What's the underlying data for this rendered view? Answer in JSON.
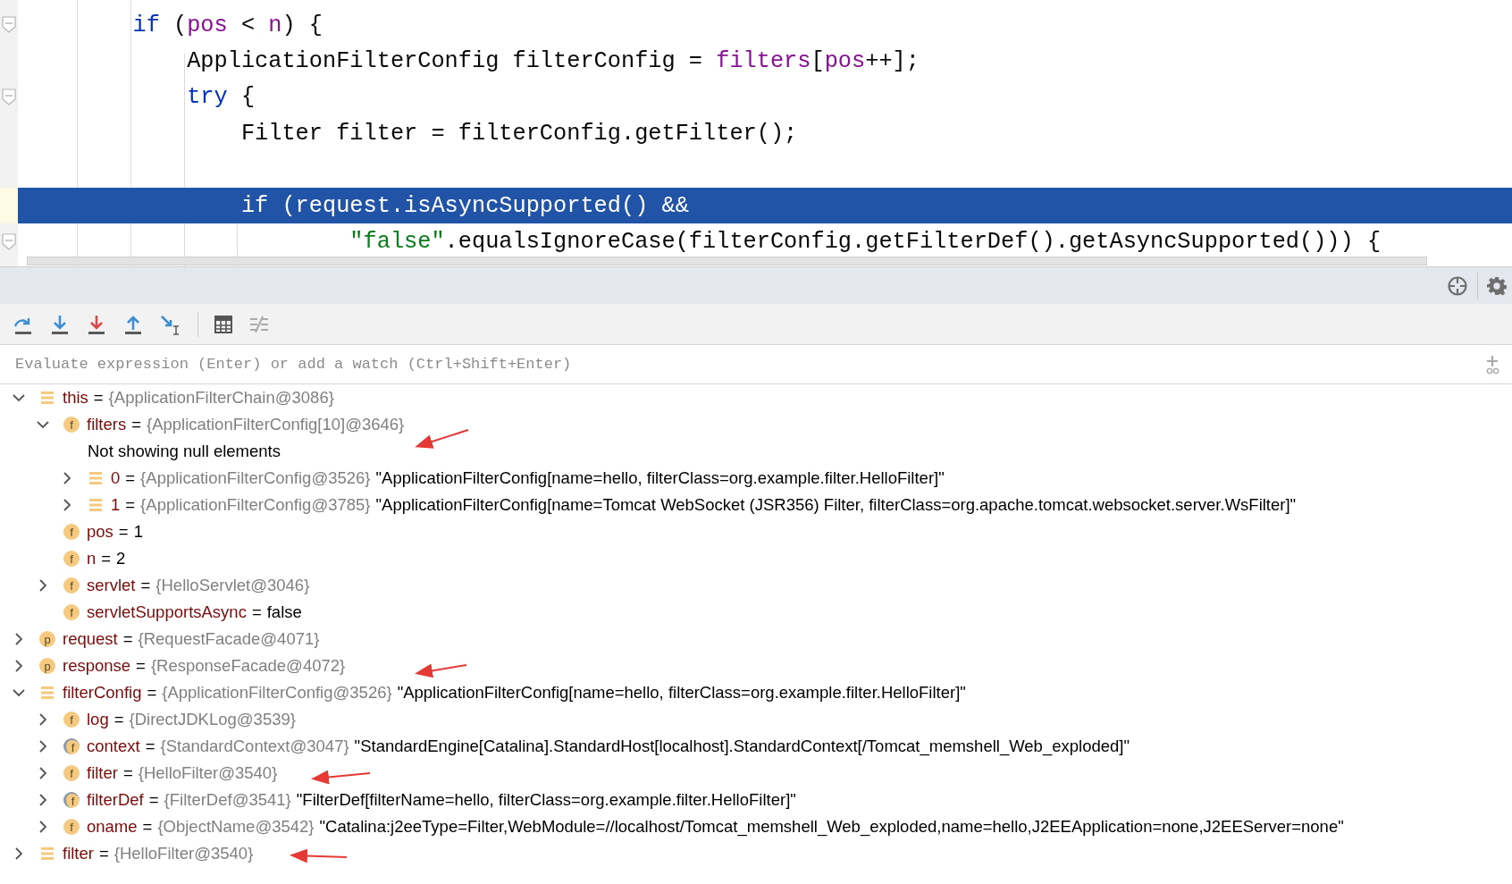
{
  "editor": {
    "lines": [
      {
        "kind": "code",
        "foldable": true,
        "current": false,
        "tokens": [
          {
            "kind": "keyword",
            "text": "        if"
          },
          {
            "kind": "plain",
            "text": " ("
          },
          {
            "kind": "field",
            "text": "pos"
          },
          {
            "kind": "plain",
            "text": " < "
          },
          {
            "kind": "field",
            "text": "n"
          },
          {
            "kind": "plain",
            "text": ") {"
          }
        ]
      },
      {
        "kind": "code",
        "foldable": false,
        "current": false,
        "tokens": [
          {
            "kind": "plain",
            "text": "            ApplicationFilterConfig filterConfig = "
          },
          {
            "kind": "field",
            "text": "filters"
          },
          {
            "kind": "plain",
            "text": "["
          },
          {
            "kind": "field",
            "text": "pos"
          },
          {
            "kind": "plain",
            "text": "++];"
          }
        ]
      },
      {
        "kind": "code",
        "foldable": true,
        "current": false,
        "tokens": [
          {
            "kind": "keyword",
            "text": "            try"
          },
          {
            "kind": "plain",
            "text": " {"
          }
        ]
      },
      {
        "kind": "code",
        "foldable": false,
        "current": false,
        "tokens": [
          {
            "kind": "plain",
            "text": "                Filter filter = filterConfig.getFilter();"
          }
        ]
      },
      {
        "kind": "blank"
      },
      {
        "kind": "code",
        "foldable": false,
        "current": true,
        "tokens": [
          {
            "kind": "plain",
            "text": "                if (request.isAsyncSupported() &&"
          }
        ]
      },
      {
        "kind": "code",
        "foldable": true,
        "current": false,
        "tokens": [
          {
            "kind": "string",
            "text": "                        \"false\""
          },
          {
            "kind": "plain",
            "text": ".equalsIgnoreCase(filterConfig.getFilterDef().getAsyncSupported())) {"
          }
        ]
      }
    ]
  },
  "evaluate": {
    "placeholder": "Evaluate expression (Enter) or add a watch (Ctrl+Shift+Enter)"
  },
  "variables": [
    {
      "kind": "object",
      "name": "this",
      "operator": "=",
      "ref": "{ApplicationFilterChain@3086}",
      "expanded": true,
      "children": [
        {
          "kind": "field",
          "badge": "f",
          "name": "filters",
          "operator": "=",
          "ref": "{ApplicationFilterConfig[10]@3646}",
          "expanded": true,
          "children": [
            {
              "kind": "message",
              "text": "Not showing null elements"
            },
            {
              "kind": "object",
              "name": "0",
              "operator": "=",
              "ref": "{ApplicationFilterConfig@3526}",
              "value": "\"ApplicationFilterConfig[name=hello, filterClass=org.example.filter.HelloFilter]\"",
              "expanded": false
            },
            {
              "kind": "object",
              "name": "1",
              "operator": "=",
              "ref": "{ApplicationFilterConfig@3785}",
              "value": "\"ApplicationFilterConfig[name=Tomcat WebSocket (JSR356) Filter, filterClass=org.apache.tomcat.websocket.server.WsFilter]\"",
              "expanded": false
            }
          ]
        },
        {
          "kind": "field",
          "badge": "f",
          "name": "pos",
          "operator": "=",
          "value": "1"
        },
        {
          "kind": "field",
          "badge": "f",
          "name": "n",
          "operator": "=",
          "value": "2"
        },
        {
          "kind": "field",
          "badge": "f",
          "name": "servlet",
          "operator": "=",
          "ref": "{HelloServlet@3046}",
          "expanded": false
        },
        {
          "kind": "field",
          "badge": "f",
          "name": "servletSupportsAsync",
          "operator": "=",
          "value": "false"
        }
      ]
    },
    {
      "kind": "field",
      "badge": "p",
      "name": "request",
      "operator": "=",
      "ref": "{RequestFacade@4071}",
      "expanded": false
    },
    {
      "kind": "field",
      "badge": "p",
      "name": "response",
      "operator": "=",
      "ref": "{ResponseFacade@4072}",
      "expanded": false
    },
    {
      "kind": "object",
      "name": "filterConfig",
      "operator": "=",
      "ref": "{ApplicationFilterConfig@3526}",
      "value": "\"ApplicationFilterConfig[name=hello, filterClass=org.example.filter.HelloFilter]\"",
      "expanded": true,
      "children": [
        {
          "kind": "field",
          "badge": "f",
          "name": "log",
          "operator": "=",
          "ref": "{DirectJDKLog@3539}",
          "expanded": false
        },
        {
          "kind": "field",
          "badge": "f",
          "marked": true,
          "name": "context",
          "operator": "=",
          "ref": "{StandardContext@3047}",
          "value": "\"StandardEngine[Catalina].StandardHost[localhost].StandardContext[/Tomcat_memshell_Web_exploded]\"",
          "expanded": false
        },
        {
          "kind": "field",
          "badge": "f",
          "name": "filter",
          "operator": "=",
          "ref": "{HelloFilter@3540}",
          "expanded": false
        },
        {
          "kind": "field",
          "badge": "f",
          "marked": true,
          "name": "filterDef",
          "operator": "=",
          "ref": "{FilterDef@3541}",
          "value": "\"FilterDef[filterName=hello, filterClass=org.example.filter.HelloFilter]\"",
          "expanded": false
        },
        {
          "kind": "field",
          "badge": "f",
          "name": "oname",
          "operator": "=",
          "ref": "{ObjectName@3542}",
          "value": "\"Catalina:j2eeType=Filter,WebModule=//localhost/Tomcat_memshell_Web_exploded,name=hello,J2EEApplication=none,J2EEServer=none\"",
          "expanded": false
        }
      ]
    },
    {
      "kind": "object",
      "name": "filter",
      "operator": "=",
      "ref": "{HelloFilter@3540}",
      "expanded": false
    }
  ]
}
